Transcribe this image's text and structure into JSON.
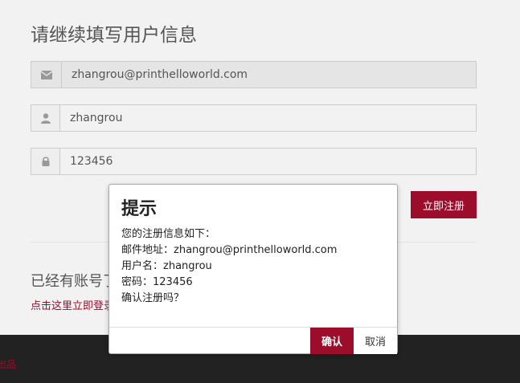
{
  "page": {
    "title": "请继续填写用户信息",
    "have_account": "已经有账号了",
    "login_link": "点击这里立即登录",
    "footer_text": "出品"
  },
  "form": {
    "email": {
      "value": "zhangrou@printhelloworld.com",
      "icon": "envelope-icon"
    },
    "username": {
      "value": "zhangrou",
      "icon": "user-icon"
    },
    "password": {
      "value": "123456",
      "icon": "lock-icon"
    },
    "register_label": "立即注册"
  },
  "dialog": {
    "title": "提示",
    "line1": "您的注册信息如下：",
    "line2": "邮件地址：zhangrou@printhelloworld.com",
    "line3": "用户名：zhangrou",
    "line4": "密码：123456",
    "line5": "确认注册吗？",
    "confirm_label": "确认",
    "cancel_label": "取消"
  },
  "colors": {
    "accent": "#9b0d2b",
    "footer_bg": "#222222",
    "page_bg": "#f2f2f2"
  }
}
